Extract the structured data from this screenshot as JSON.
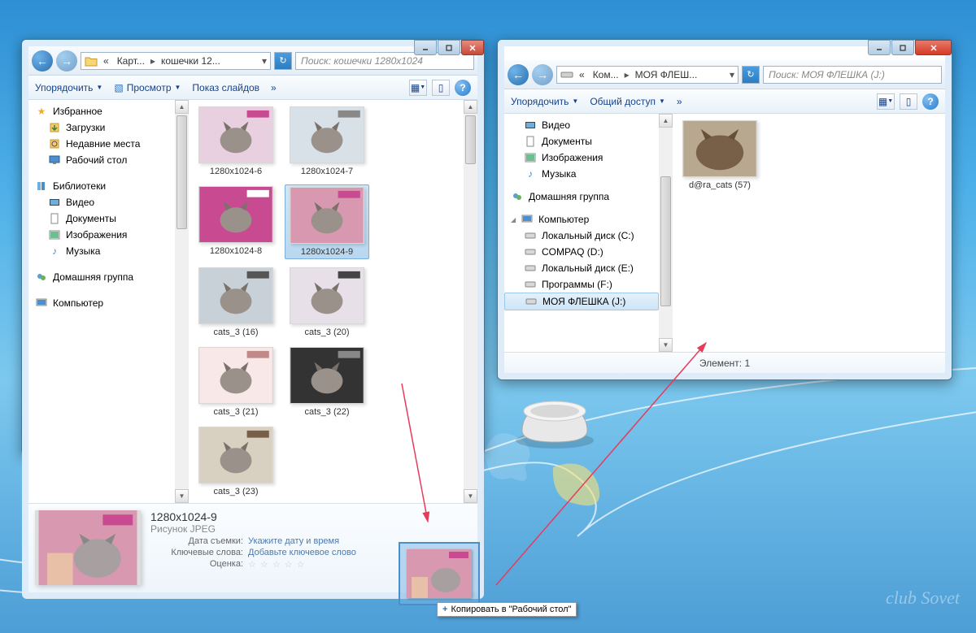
{
  "window1": {
    "breadcrumb_prefix": "«",
    "breadcrumb1": "Карт...",
    "breadcrumb2": "кошечки 12...",
    "search_placeholder": "Поиск: кошечки 1280x1024",
    "toolbar": {
      "organize": "Упорядочить",
      "view": "Просмотр",
      "slideshow": "Показ слайдов",
      "more": "»"
    },
    "sidebar": {
      "favorites_head": "Избранное",
      "favorites": [
        "Загрузки",
        "Недавние места",
        "Рабочий стол"
      ],
      "libraries_head": "Библиотеки",
      "libraries": [
        "Видео",
        "Документы",
        "Изображения",
        "Музыка"
      ],
      "homegroup": "Домашняя группа",
      "computer": "Компьютер"
    },
    "thumbs": [
      "1280x1024-6",
      "1280x1024-7",
      "1280x1024-8",
      "1280x1024-9",
      "cats_3 (16)",
      "cats_3 (20)",
      "cats_3 (21)",
      "cats_3 (22)",
      "cats_3 (23)"
    ],
    "details": {
      "name": "1280x1024-9",
      "type": "Рисунок JPEG",
      "date_label": "Дата съемки:",
      "date_val": "Укажите дату и время",
      "keywords_label": "Ключевые слова:",
      "keywords_val": "Добавьте ключевое слово",
      "rating_label": "Оценка:"
    }
  },
  "window2": {
    "breadcrumb1": "Ком...",
    "breadcrumb2": "МОЯ ФЛЕШ...",
    "search_placeholder": "Поиск: МОЯ ФЛЕШКА (J:)",
    "toolbar": {
      "organize": "Упорядочить",
      "share": "Общий доступ",
      "more": "»"
    },
    "sidebar": {
      "libraries": [
        "Видео",
        "Документы",
        "Изображения",
        "Музыка"
      ],
      "homegroup": "Домашняя группа",
      "computer": "Компьютер",
      "drives": [
        "Локальный диск (C:)",
        "COMPAQ (D:)",
        "Локальный диск (E:)",
        "Программы  (F:)",
        "МОЯ ФЛЕШКА (J:)"
      ]
    },
    "thumbs": [
      "d@ra_cats (57)"
    ],
    "statusbar": "Элемент: 1"
  },
  "dragtip": "Копировать в \"Рабочий стол\"",
  "watermark": "club Sovet"
}
